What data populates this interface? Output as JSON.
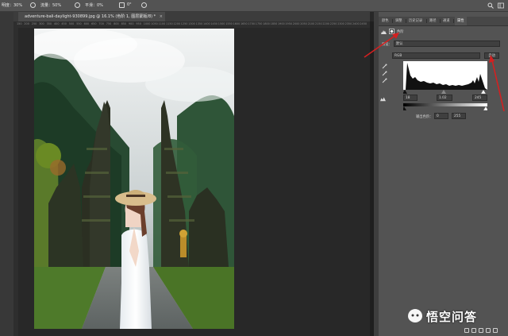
{
  "options_bar": {
    "opacity_label": "明度：30%",
    "flow_label": "流量：50%",
    "smoothing_label": "平滑：0%",
    "angle_label": "0°"
  },
  "document": {
    "tab_title": "adventure-bali-daylight-930899.jpg @ 16.1% (色阶 1, 图层蒙版/8) *",
    "close": "×",
    "ruler_ticks": [
      "150",
      "200",
      "250",
      "300",
      "350",
      "400",
      "450",
      "500",
      "550",
      "600",
      "650",
      "700",
      "750",
      "800",
      "850",
      "900",
      "950",
      "1000",
      "1050",
      "1100",
      "1150",
      "1200",
      "1250",
      "1300",
      "1350",
      "1400",
      "1450",
      "1500",
      "1550",
      "1600",
      "1650",
      "1700",
      "1750",
      "1800",
      "1850",
      "1900",
      "1950",
      "2000",
      "2050",
      "2100",
      "2150",
      "2200",
      "2250",
      "2300",
      "2350",
      "2400",
      "2450"
    ]
  },
  "panel": {
    "tabs": [
      "颜色",
      "调整",
      "历史记录",
      "路径",
      "通道",
      "属性"
    ],
    "active_tab": "属性",
    "title": "色阶",
    "preset_label": "预设：",
    "preset_value": "默认",
    "channel_value": "RGB",
    "auto_label": "自动",
    "input_shadow": "18",
    "input_mid": "1.02",
    "input_highlight": "245",
    "output_label": "输出色阶：",
    "output_low": "0",
    "output_high": "255"
  },
  "watermark": {
    "text": "悟空问答"
  },
  "colors": {
    "arrow_red": "#d42020",
    "panel_bg": "#535353",
    "app_bg": "#282828"
  }
}
